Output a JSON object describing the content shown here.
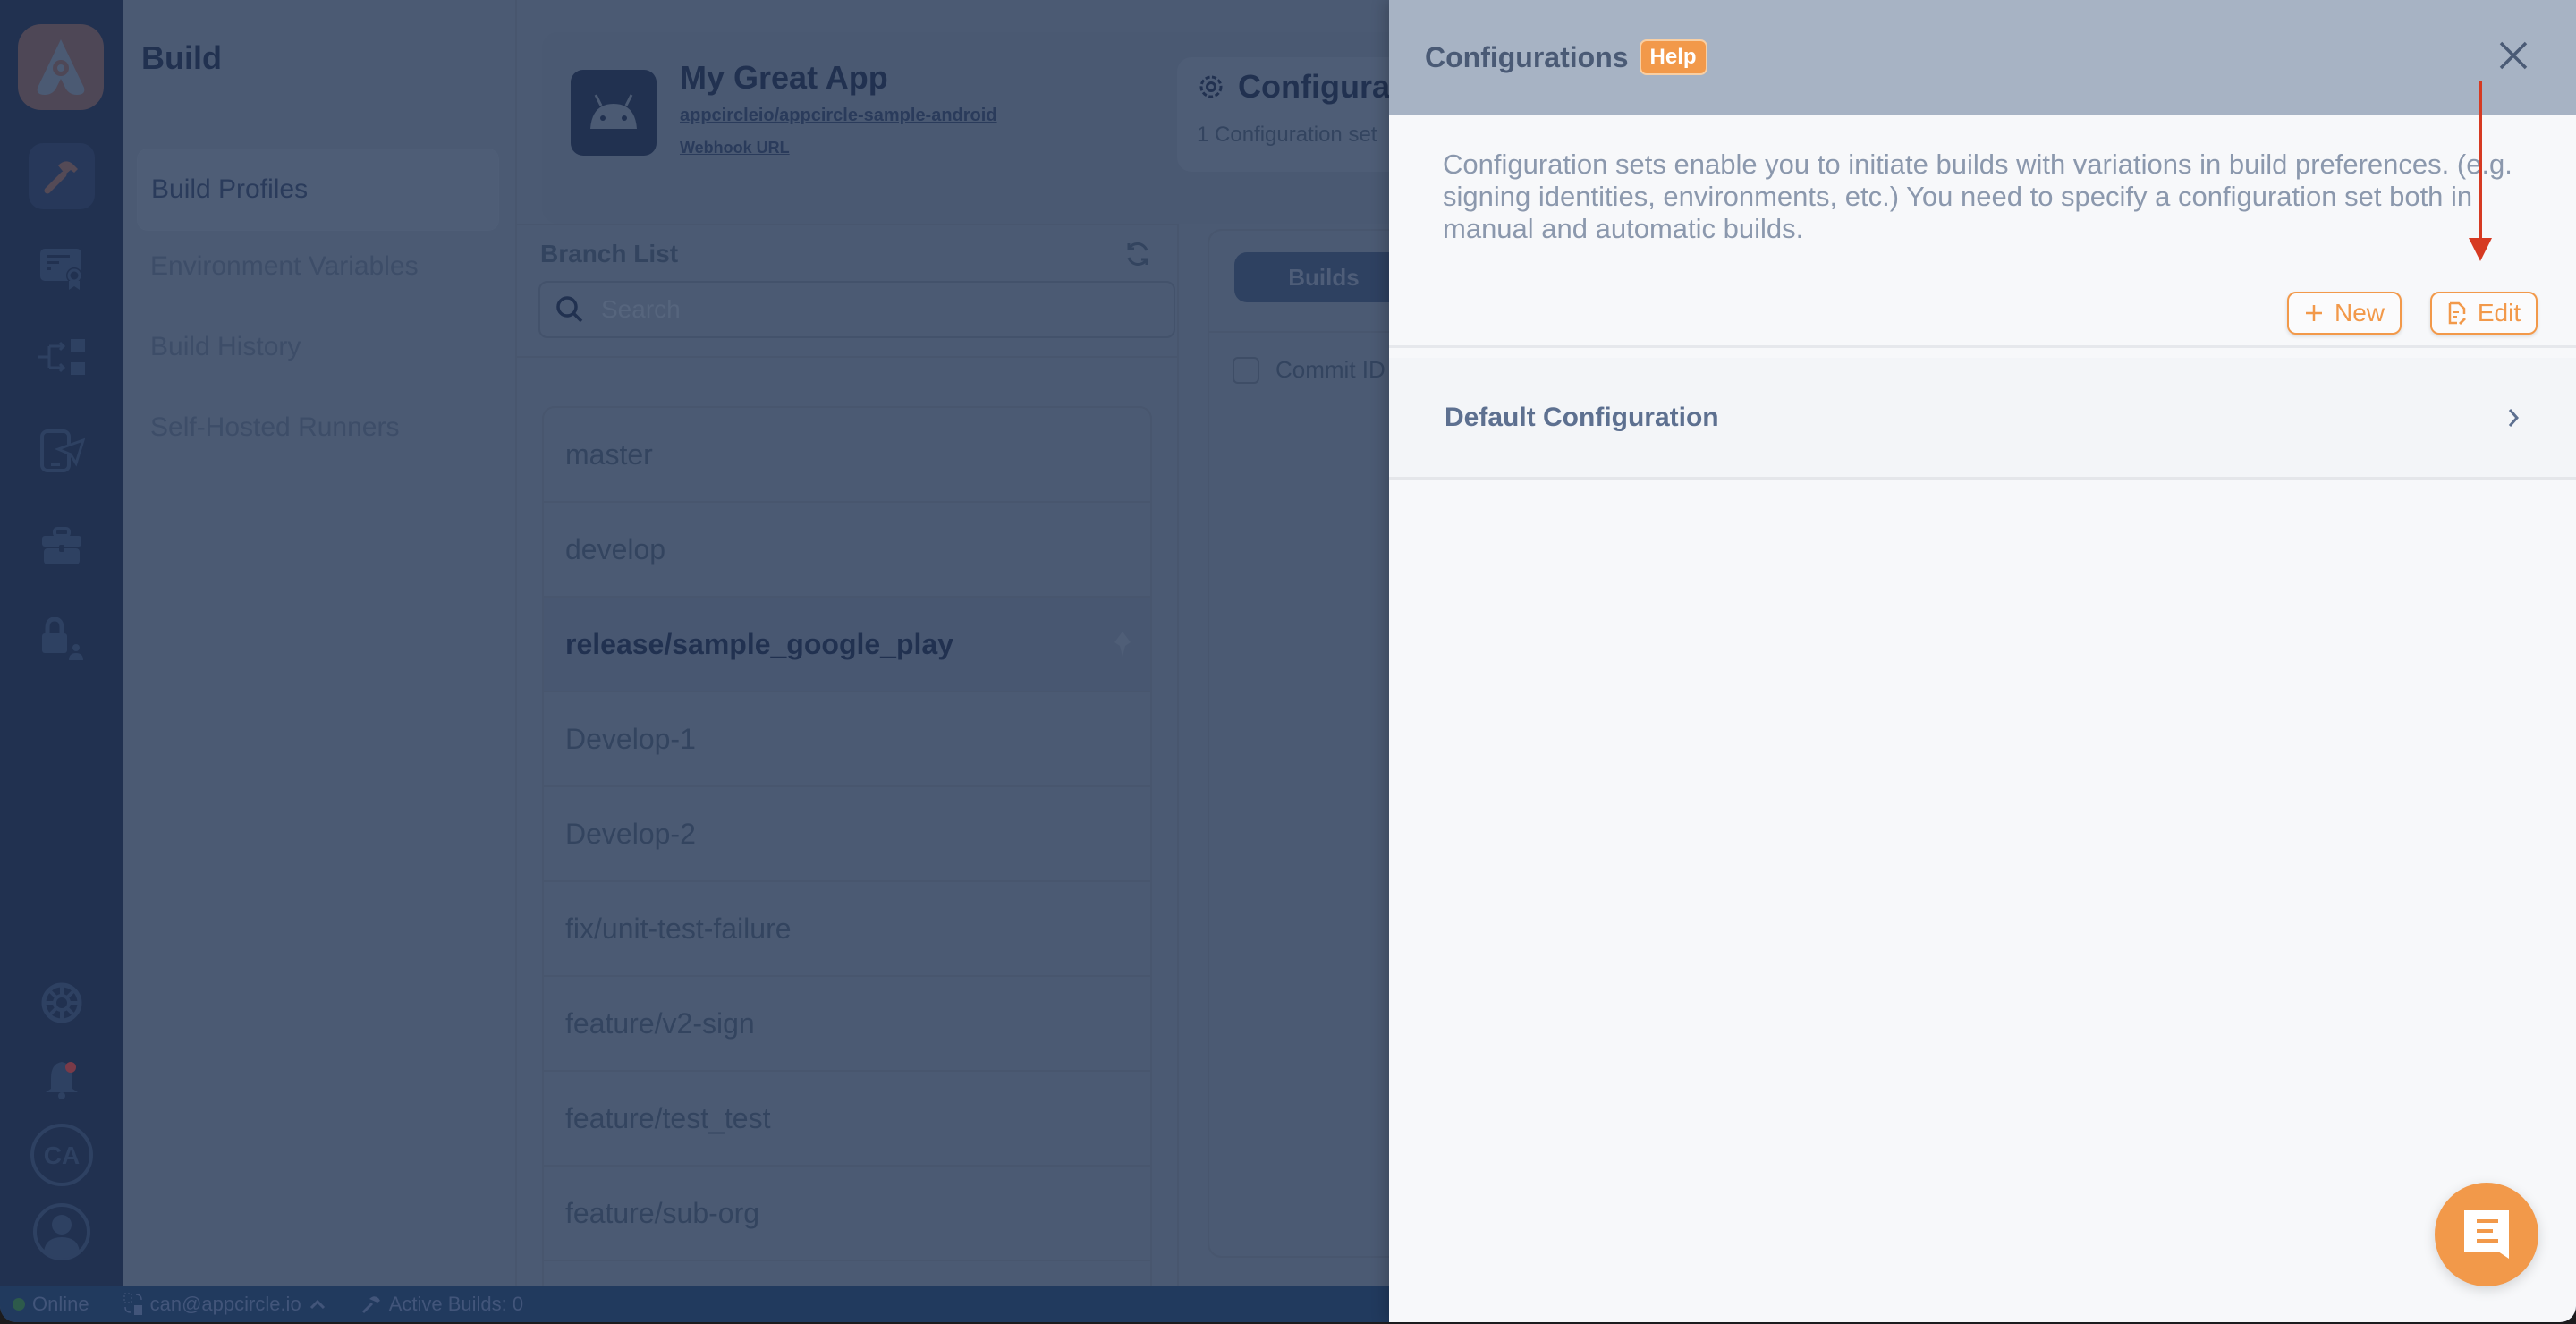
{
  "rail": {
    "logo": "appcircle-logo",
    "items": [
      {
        "icon": "hammer-icon",
        "label": "Build",
        "active": true
      },
      {
        "icon": "certificate-icon",
        "label": "Signing Identities"
      },
      {
        "icon": "distribution-icon",
        "label": "Distribution"
      },
      {
        "icon": "testing-icon",
        "label": "Testing Distribution"
      },
      {
        "icon": "briefcase-icon",
        "label": "Enterprise App Store"
      },
      {
        "icon": "lock-user-icon",
        "label": "Account"
      }
    ],
    "bottom": {
      "avatar_initials": "CA"
    }
  },
  "subnav": {
    "title": "Build",
    "items": [
      {
        "label": "Build Profiles",
        "active": true
      },
      {
        "label": "Environment Variables"
      },
      {
        "label": "Build History"
      },
      {
        "label": "Self-Hosted Runners"
      }
    ]
  },
  "main": {
    "app_name": "My Great App",
    "repo": "appcircleio/appcircle-sample-android",
    "webhook": "Webhook URL",
    "config_title": "Configura",
    "config_sub": "1 Configuration set",
    "branch_list_title": "Branch List",
    "search_placeholder": "Search",
    "branches": [
      {
        "name": "master"
      },
      {
        "name": "develop"
      },
      {
        "name": "release/sample_google_play",
        "selected": true
      },
      {
        "name": "Develop-1"
      },
      {
        "name": "Develop-2"
      },
      {
        "name": "fix/unit-test-failure"
      },
      {
        "name": "feature/v2-sign"
      },
      {
        "name": "feature/test_test"
      },
      {
        "name": "feature/sub-org"
      }
    ],
    "builds_tab": "Builds",
    "commit_col": "Commit ID"
  },
  "statusbar": {
    "online": "Online",
    "user": "can@appcircle.io",
    "active_builds": "Active Builds: 0"
  },
  "drawer": {
    "title": "Configurations",
    "help": "Help",
    "description": "Configuration sets enable you to initiate builds with variations in build preferences. (e.g. signing identities, environments, etc.) You need to specify a configuration set both in manual and automatic builds.",
    "new_label": "New",
    "edit_label": "Edit",
    "configs": [
      {
        "name": "Default Configuration"
      }
    ]
  },
  "colors": {
    "accent": "#f2994a",
    "annotation_arrow": "#d63a22",
    "rail": "#213150"
  }
}
